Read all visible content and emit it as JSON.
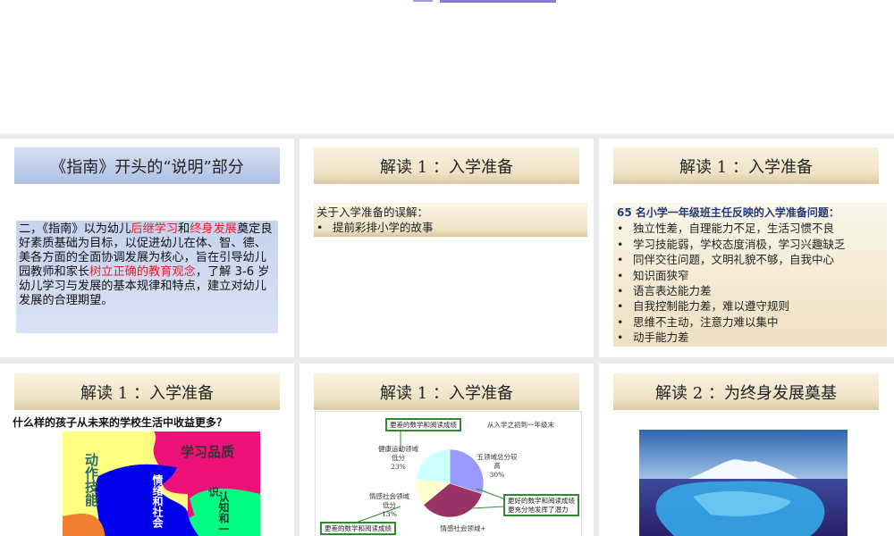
{
  "slides": [
    {
      "title": "《指南》开头的“说明”部分",
      "body": [
        {
          "t": "二，《指南》以为幼儿",
          "c": ""
        },
        {
          "t": "后继学习",
          "c": "red"
        },
        {
          "t": "和",
          "c": ""
        },
        {
          "t": "终身发展",
          "c": "red"
        },
        {
          "t": "奠定良好素质基础为目标，以促进幼儿在体、智、德、美各方面的全面协调发展为核心，旨在引导幼儿园教师和家长",
          "c": ""
        },
        {
          "t": "树立正确的教育观念",
          "c": "red"
        },
        {
          "t": "，了解 3-6 岁幼儿学习与发展的基本规律和特点，建立对幼儿发展的合理期望。",
          "c": ""
        }
      ]
    },
    {
      "title": "解读 1 ：入学准备",
      "heading": "关于入学准备的误解：",
      "bullets": [
        "提前彩排小学的故事"
      ]
    },
    {
      "title": "解读 1 ：入学准备",
      "heading": "65 名小学一年级班主任反映的入学准备问题：",
      "bullets": [
        "独立性差，自理能力不足，生活习惯不良",
        "学习技能弱，学校态度消极，学习兴趣缺乏",
        "同伴交往问题，文明礼貌不够，自我中心",
        "知识面狭窄",
        "语言表达能力差",
        "自我控制能力差，难以遵守规则",
        "思维不主动，注意力难以集中",
        "动手能力差"
      ]
    },
    {
      "title": "解读 1 ：入学准备",
      "question": "什么样的孩子从未来的学校生活中收益更多？",
      "puzzle": {
        "motor": "动作技能",
        "learning": "学习品质",
        "emotion": "情绪和社会",
        "cognition": "认知和一",
        "knowledge": "识"
      }
    },
    {
      "title": "解读 1 ：入学准备",
      "note": "从入学之初到一年级末",
      "boxes": [
        "更差的数学和阅读成绩",
        "更好的数学和阅读成绩",
        "更充分地发挥了潜力",
        "更差的数学和阅读成绩"
      ],
      "labels": [
        {
          "name": "五领域总分较高",
          "l1": "五领域总分较",
          "l2": "高",
          "pct": "30%"
        },
        {
          "name": "情感社会领域+",
          "l1": "情感社会领域+",
          "l2": "",
          "pct": ""
        },
        {
          "name": "情感社会领域低分",
          "l1": "情感社会领域",
          "l2": "低分",
          "pct": "13%"
        },
        {
          "name": "健康运动领域低分",
          "l1": "健康运动领域",
          "l2": "低分",
          "pct": "23%"
        }
      ]
    },
    {
      "title": "解读 2 ：为终身发展奠基"
    }
  ],
  "chart_data": {
    "type": "pie",
    "categories": [
      "五领域总分较高",
      "情感社会领域+",
      "情感社会领域低分",
      "健康运动领域低分"
    ],
    "values": [
      30,
      34,
      13,
      23
    ],
    "colors": [
      "#9999ff",
      "#993366",
      "#ffffcc",
      "#ccffff"
    ]
  }
}
